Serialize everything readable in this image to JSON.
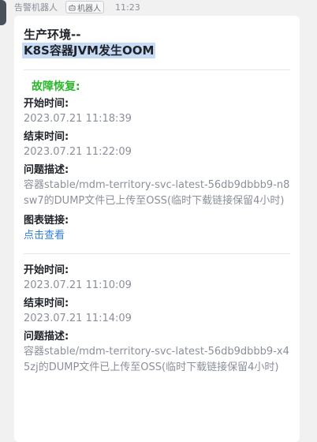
{
  "header": {
    "sender_name": "告警机器人",
    "bot_tag": "机器人",
    "timestamp": "11:23"
  },
  "card": {
    "title_line1": "生产环境--",
    "title_line2": "K8S容器JVM发生OOM",
    "section_title": "故障恢复:",
    "labels": {
      "start": "开始时间:",
      "end": "结束时间:",
      "desc": "问题描述:",
      "chart": "图表链接:"
    },
    "entries": [
      {
        "start_time": "2023.07.21 11:18:39",
        "end_time": "2023.07.21 11:22:09",
        "description": "容器stable/mdm-territory-svc-latest-56db9dbbb9-n8sw7的DUMP文件已上传至OSS(临时下载链接保留4小时)",
        "chart_link": "点击查看"
      },
      {
        "start_time": "2023.07.21 11:10:09",
        "end_time": "2023.07.21 11:14:09",
        "description": "容器stable/mdm-territory-svc-latest-56db9dbbb9-x45zj的DUMP文件已上传至OSS(临时下载链接保留4小时)"
      }
    ]
  },
  "colors": {
    "section_title": "#2cb72c",
    "link": "#2f7fe5",
    "highlight": "#c7dbf5",
    "value_text": "#8a8f99"
  }
}
